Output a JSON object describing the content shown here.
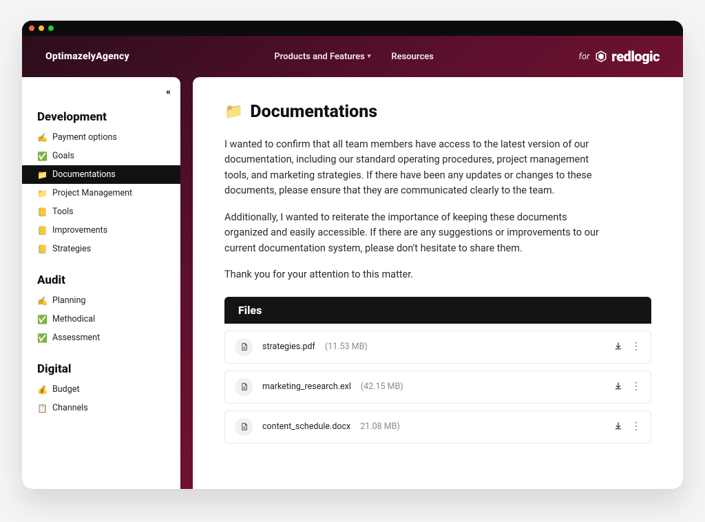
{
  "header": {
    "brand": "OptimazelyAgency",
    "nav": [
      {
        "label": "Products and Features",
        "has_submenu": true
      },
      {
        "label": "Resources",
        "has_submenu": false
      }
    ],
    "for_label": "for",
    "partner_logo_text": "redlogic"
  },
  "sidebar": {
    "groups": [
      {
        "title": "Development",
        "items": [
          {
            "icon": "✍️",
            "label": "Payment options",
            "active": false
          },
          {
            "icon": "✅",
            "label": "Goals",
            "active": false
          },
          {
            "icon": "📁",
            "label": "Documentations",
            "active": true
          },
          {
            "icon": "📁",
            "label": "Project Management",
            "active": false
          },
          {
            "icon": "📒",
            "label": "Tools",
            "active": false
          },
          {
            "icon": "📒",
            "label": "Improvements",
            "active": false
          },
          {
            "icon": "📒",
            "label": "Strategies",
            "active": false
          }
        ]
      },
      {
        "title": "Audit",
        "items": [
          {
            "icon": "✍️",
            "label": "Planning",
            "active": false
          },
          {
            "icon": "✅",
            "label": "Methodical",
            "active": false
          },
          {
            "icon": "✅",
            "label": "Assessment",
            "active": false
          }
        ]
      },
      {
        "title": "Digital",
        "items": [
          {
            "icon": "💰",
            "label": "Budget",
            "active": false
          },
          {
            "icon": "📋",
            "label": "Channels",
            "active": false
          }
        ]
      }
    ]
  },
  "page": {
    "icon": "📁",
    "title": "Documentations",
    "paragraphs": [
      "I wanted to confirm that all team members have access to the latest version of our documentation, including our standard operating procedures, project management tools, and marketing strategies. If there have been any updates or changes to these documents, please ensure that they are communicated clearly to the team.",
      "Additionally, I wanted to reiterate the importance of keeping these documents organized and easily accessible. If there are any suggestions or improvements to our current documentation system, please don't hesitate to share them.",
      "Thank you for your attention to this matter."
    ],
    "files_header": "Files",
    "files": [
      {
        "name": "strategies.pdf",
        "size": "(11.53 MB)"
      },
      {
        "name": "marketing_research.exl",
        "size": "(42.15 MB)"
      },
      {
        "name": "content_schedule.docx",
        "size": "21.08 MB)"
      }
    ]
  }
}
